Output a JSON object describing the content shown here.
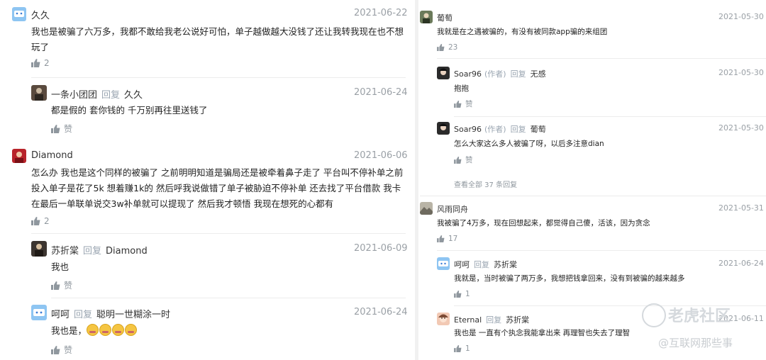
{
  "left": {
    "comments": [
      {
        "name": "久久",
        "date": "2021-06-22",
        "text": "我也是被骗了六万多，我都不敢给我老公说好可怕，单子越做越大没钱了还让我转我现在也不想玩了",
        "likes": "2"
      },
      {
        "name": "一条小团团",
        "reply_label": "回复",
        "reply_to": "久久",
        "date": "2021-06-24",
        "text": "都是假的 套你钱的 千万别再往里送钱了",
        "likes": "赞"
      },
      {
        "name": "Diamond",
        "date": "2021-06-06",
        "text": "怎么办 我也是这个同样的被骗了 之前明明知道是骗局还是被牵着鼻子走了 平台叫不停补单之前投入单子是花了5k 想着赚1k的 然后呼我说做错了单子被胁迫不停补单 还去找了平台借款 我卡在最后一单联单说交3w补单就可以提现了 然后我才顿悟 我现在想死的心都有",
        "likes": "2"
      },
      {
        "name": "苏折棠",
        "reply_label": "回复",
        "reply_to": "Diamond",
        "date": "2021-06-09",
        "text": "我也",
        "likes": "赞"
      },
      {
        "name": "呵呵",
        "reply_label": "回复",
        "reply_to": "聪明一世糊涂一时",
        "date": "2021-06-24",
        "text": "我也是，",
        "likes": "赞"
      }
    ]
  },
  "right": {
    "comments": [
      {
        "name": "葡萄",
        "date": "2021-05-30",
        "text": "我就是在之遇被骗的，有没有被同款app骗的来组团",
        "likes": "23"
      },
      {
        "name": "Soar96",
        "author_tag": "(作者)",
        "reply_label": "回复",
        "reply_to": "无感",
        "date": "2021-05-30",
        "text": "抱抱",
        "likes": "赞"
      },
      {
        "name": "Soar96",
        "author_tag": "(作者)",
        "reply_label": "回复",
        "reply_to": "葡萄",
        "date": "2021-05-30",
        "text": "怎么大家这么多人被骗了呀，以后多注意dian",
        "likes": "赞"
      },
      {
        "name": "风雨同舟",
        "date": "2021-05-31",
        "text": "我被骗了4万多，现在回想起来，都觉得自己傻，活该，因为贪念",
        "likes": "17"
      },
      {
        "name": "呵呵",
        "reply_label": "回复",
        "reply_to": "苏折棠",
        "date": "2021-06-24",
        "text": "我就是，当时被骗了两万多，我想把钱拿回来，没有到被骗的越来越多",
        "likes": "1"
      },
      {
        "name": "Eternal",
        "reply_label": "回复",
        "reply_to": "苏折棠",
        "date": "2021-06-11",
        "text": "我也是 一直有个执念我能拿出来 再理智也失去了理智",
        "likes": "1"
      }
    ],
    "view_all": "查看全部 37 条回复"
  },
  "watermark": {
    "line1": "老虎社区",
    "line2": "@互联网那些事"
  },
  "colors": {
    "reply_gray": "#9aa5b1",
    "date_gray": "#9aa0a6",
    "text_dark": "#222222",
    "like_gray": "#8f979e"
  }
}
